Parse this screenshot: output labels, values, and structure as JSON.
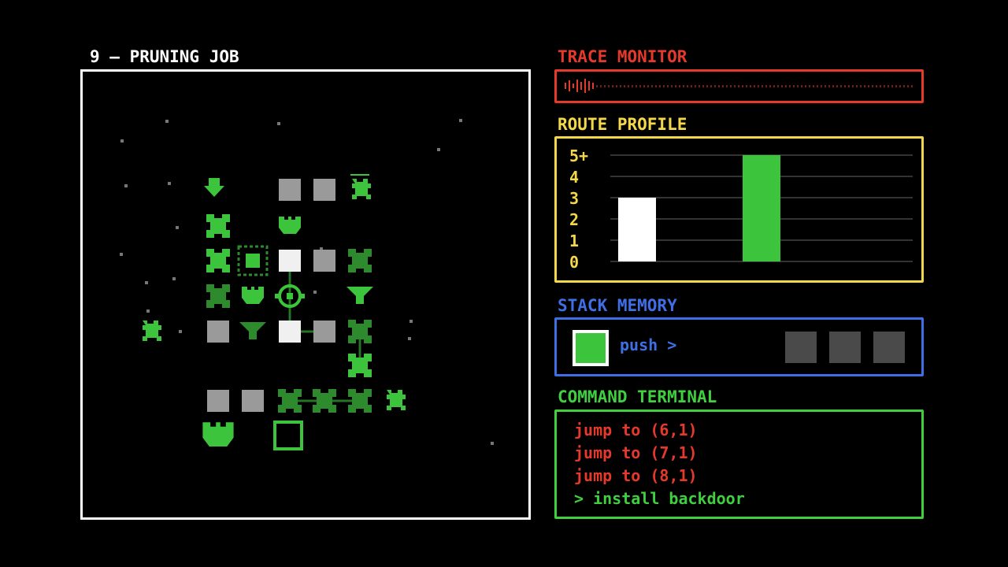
{
  "level": {
    "title": "9 — PRUNING JOB"
  },
  "colors": {
    "trace": "#e53a2b",
    "route": "#f4d84a",
    "stack": "#3f6fe6",
    "terminal": "#3fcf3f",
    "terminal_history": "#e53a2b",
    "node_green": "#3cc43c",
    "node_grey": "#9a9a9a"
  },
  "trace_monitor": {
    "title": "TRACE MONITOR",
    "level": 0.09
  },
  "route_profile": {
    "title": "ROUTE PROFILE",
    "y_labels": [
      "5+",
      "4",
      "3",
      "2",
      "1",
      "0"
    ]
  },
  "chart_data": {
    "type": "bar",
    "categories": [
      "",
      ""
    ],
    "values": [
      3,
      5
    ],
    "bar_colors": [
      "#ffffff",
      "#3cc43c"
    ],
    "ylim": [
      0,
      5
    ],
    "y_tick_labels": [
      "0",
      "1",
      "2",
      "3",
      "4",
      "5+"
    ],
    "grid": true
  },
  "stack_memory": {
    "title": "STACK MEMORY",
    "action": "push >",
    "current_color": "#3cc43c",
    "empty_slots": 3
  },
  "command_terminal": {
    "title": "COMMAND TERMINAL",
    "history": [
      "jump to (6,1)",
      "jump to (7,1)",
      "jump to (8,1)"
    ],
    "prompt": "> install backdoor"
  },
  "board": {
    "icons": [
      "bug-node-icon",
      "shield-node-icon",
      "filter-node-icon",
      "ram-node-icon",
      "x-node-icon",
      "grey-block-icon",
      "target-cursor-icon",
      "empty-slot-icon"
    ]
  }
}
